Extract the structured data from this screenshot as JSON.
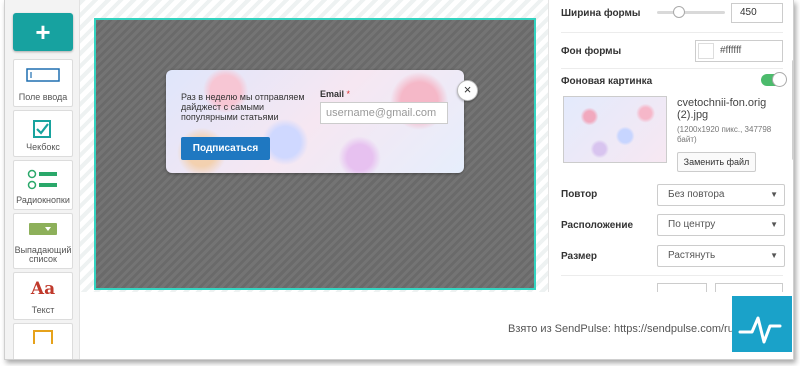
{
  "toolbox": {
    "add_label": "+",
    "tools": [
      {
        "label": "Поле ввода",
        "icon": "input-field-icon"
      },
      {
        "label": "Чекбокс",
        "icon": "checkbox-icon"
      },
      {
        "label": "Радиокнопки",
        "icon": "radio-buttons-icon"
      },
      {
        "label": "Выпадающий список",
        "icon": "dropdown-icon"
      },
      {
        "label": "Текст",
        "icon": "text-icon"
      },
      {
        "label": "",
        "icon": "image-icon"
      }
    ]
  },
  "popup": {
    "text": "Раз в неделю мы отправляем дайджест с самыми популярными статьями",
    "button_label": "Подписаться",
    "email_label": "Email",
    "required_mark": "*",
    "email_placeholder": "username@gmail.com",
    "close_symbol": "×"
  },
  "settings": {
    "form_width": {
      "label": "Ширина формы",
      "value": "450",
      "slider_fraction": 0.33
    },
    "form_bg": {
      "label": "Фон формы",
      "value": "#ffffff"
    },
    "bg_image": {
      "label": "Фоновая картинка",
      "enabled": true,
      "file_name": "cvetochnii-fon.orig (2).jpg",
      "file_meta": "(1200x1920 пикс., 347798 байт)",
      "replace_label": "Заменить файл"
    },
    "repeat": {
      "label": "Повтор",
      "value": "Без повтора"
    },
    "position": {
      "label": "Расположение",
      "value": "По центру"
    },
    "size": {
      "label": "Размер",
      "value": "Растянуть"
    }
  },
  "footer": {
    "credit": "Взято из SendPulse: https://sendpulse.com/ru",
    "logo_icon": "sendpulse-logo-icon"
  },
  "colors": {
    "accent": "#17a2a0",
    "canvas_border": "#34d3c0",
    "subscribe_button": "#1f78c1",
    "toggle_on": "#4cbb6c",
    "logo_bg": "#1aa2c9"
  }
}
